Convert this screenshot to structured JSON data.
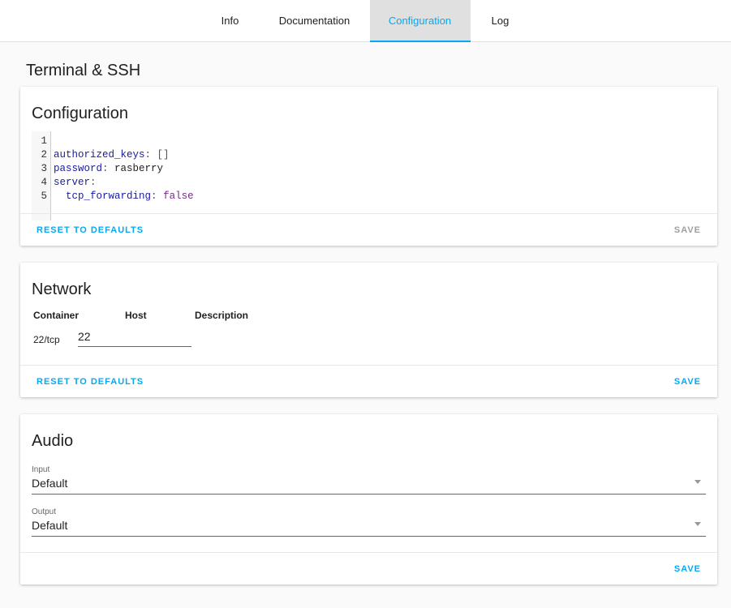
{
  "tabs": [
    "Info",
    "Documentation",
    "Configuration",
    "Log"
  ],
  "page_title": "Terminal & SSH",
  "config": {
    "title": "Configuration",
    "line_numbers": [
      "1",
      "2",
      "3",
      "4",
      "5"
    ],
    "reset": "RESET TO DEFAULTS",
    "save": "SAVE",
    "code": {
      "k1": "authorized_keys",
      "v1": "[]",
      "k2": "password",
      "v2": "rasberry",
      "k3": "server",
      "k4": "tcp_forwarding",
      "v4": "false"
    }
  },
  "network": {
    "title": "Network",
    "headers": [
      "Container",
      "Host",
      "Description"
    ],
    "container": "22/tcp",
    "host": "22",
    "reset": "RESET TO DEFAULTS",
    "save": "SAVE"
  },
  "audio": {
    "title": "Audio",
    "input_label": "Input",
    "input_value": "Default",
    "output_label": "Output",
    "output_value": "Default",
    "save": "SAVE"
  }
}
